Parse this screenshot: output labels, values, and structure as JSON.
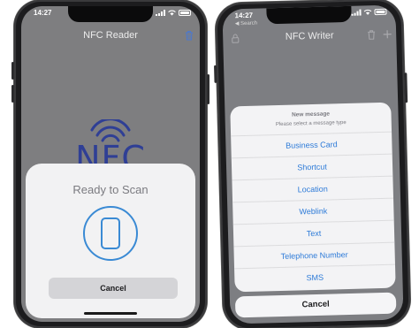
{
  "left_phone": {
    "status": {
      "time": "14:27"
    },
    "navbar": {
      "title": "NFC Reader",
      "right_icon": "trash-icon"
    },
    "logo": {
      "text": "NFC",
      "color": "#2f3f95"
    },
    "scan_sheet": {
      "title": "Ready to Scan",
      "icon": "phone-outline-icon",
      "accent": "#3a8ad4",
      "cancel_label": "Cancel"
    }
  },
  "right_phone": {
    "status": {
      "time": "14:27",
      "back_label": "◀ Search"
    },
    "navbar": {
      "title": "NFC Writer",
      "left_icon": "lock-icon",
      "right_icons": [
        "trash-icon",
        "plus-icon"
      ]
    },
    "action_sheet": {
      "title": "New message",
      "subtitle": "Please select a message type",
      "options": [
        "Business Card",
        "Shortcut",
        "Location",
        "Weblink",
        "Text",
        "Telephone Number",
        "SMS"
      ],
      "option_color": "#2c7ad8",
      "cancel_label": "Cancel"
    }
  }
}
